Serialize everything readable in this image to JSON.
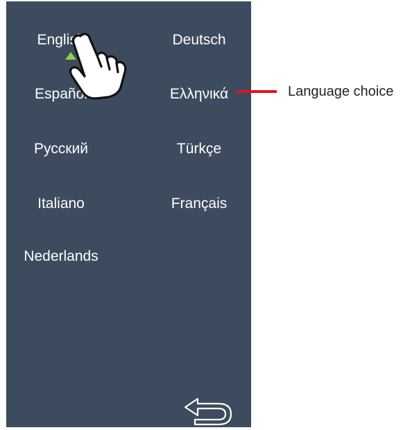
{
  "languages": {
    "english": "English",
    "deutsch": "Deutsch",
    "espanol": "Español",
    "greek": "Ελληνικά",
    "russian": "Русский",
    "turkish": "Türkçe",
    "italian": "Italiano",
    "french": "Français",
    "dutch": "Nederlands"
  },
  "selected_language": "English",
  "callout": {
    "label": "Language choice"
  },
  "icons": {
    "selection_marker": "triangle-up-icon",
    "pointer": "pointing-hand-icon",
    "back": "back-arrow-icon"
  },
  "colors": {
    "panel": "#3d4b5e",
    "text": "#ffffff",
    "selection_marker": "#8fd14a",
    "callout_line": "#e3101c"
  }
}
